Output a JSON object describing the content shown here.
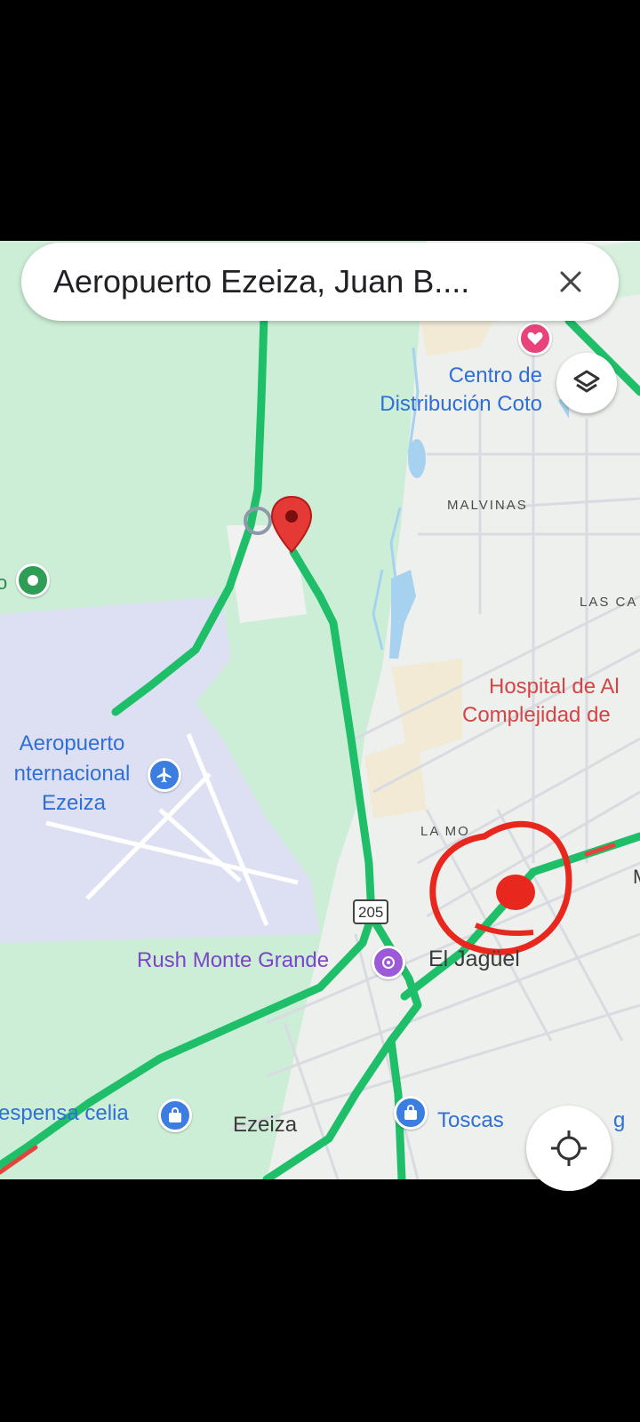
{
  "search": {
    "query": "Aeropuerto Ezeiza, Juan B...."
  },
  "map": {
    "places": {
      "malvinas": "MALVINAS",
      "las_ca": "LAS CA",
      "la_mo": "LA MO",
      "el_jaguel": "El Jagüel",
      "ezeiza": "Ezeiza"
    },
    "pois": {
      "coto_line1": "Centro de",
      "coto_line2": "Distribución Coto",
      "hospital_line1": "Hospital de Al",
      "hospital_line2": "Complejidad de",
      "airport_line1": "Aeropuerto",
      "airport_line2": "nternacional",
      "airport_line3": "Ezeiza",
      "rush": "Rush Monte Grande",
      "despensa": "espensa celia",
      "toscas": "Toscas",
      "partial_g": "g",
      "partial_m": "M",
      "partial_o": "o"
    },
    "route_shield": "205",
    "colors": {
      "traffic_green": "#1fbf6a",
      "traffic_red": "#e0463b",
      "park_green": "#cdeed6",
      "airport_lavender": "#dde0f3",
      "water": "#a6d2f0",
      "annotation_red": "#e8281e"
    }
  },
  "icons": {
    "close": "close-icon",
    "layers": "layers-icon",
    "locate": "my-location-icon",
    "pin": "location-pin-icon",
    "airport": "airplane-icon",
    "heart": "heart-icon",
    "shopping": "shopping-bag-icon",
    "rush": "gym-icon"
  }
}
